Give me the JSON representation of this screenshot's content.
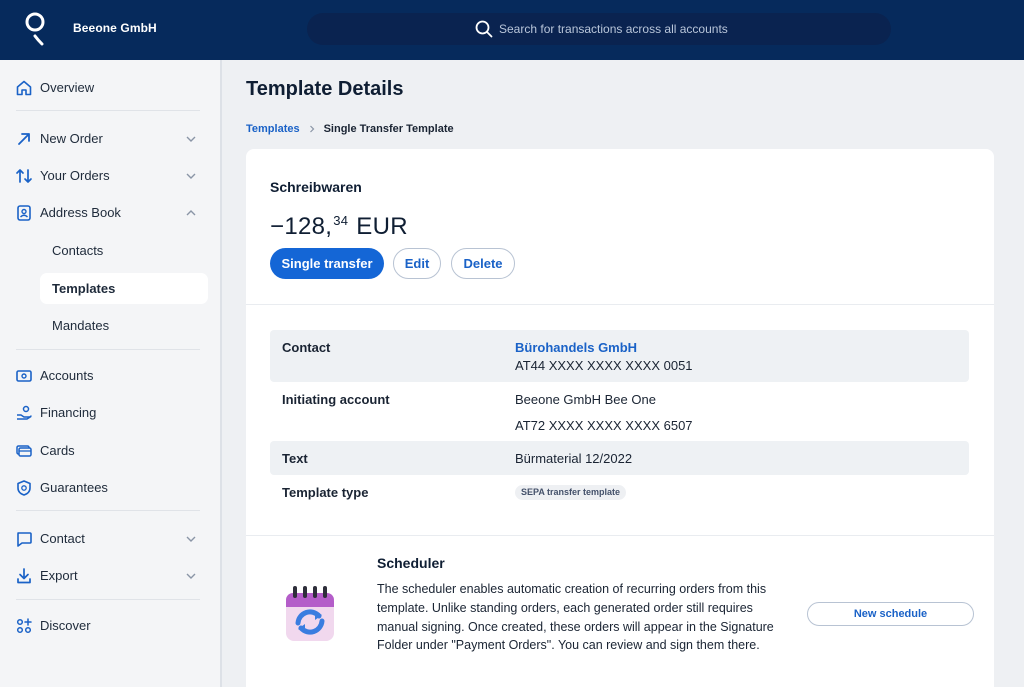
{
  "header": {
    "company": "Beeone GmbH",
    "search_placeholder": "Search for transactions across all accounts"
  },
  "sidebar": {
    "overview": "Overview",
    "new_order": "New Order",
    "your_orders": "Your Orders",
    "address_book": "Address Book",
    "contacts": "Contacts",
    "templates": "Templates",
    "mandates": "Mandates",
    "accounts": "Accounts",
    "financing": "Financing",
    "cards": "Cards",
    "guarantees": "Guarantees",
    "contact": "Contact",
    "export": "Export",
    "discover": "Discover"
  },
  "page": {
    "title": "Template Details",
    "breadcrumb": [
      "Templates",
      "Single Transfer Template"
    ]
  },
  "template": {
    "name": "Schreibwaren",
    "amount_main": "−128,",
    "amount_decimals": "34",
    "currency": "EUR",
    "buttons": {
      "single_transfer": "Single transfer",
      "edit": "Edit",
      "delete": "Delete"
    },
    "details": {
      "contact_label": "Contact",
      "contact_name": "Bürohandels GmbH",
      "contact_iban": "AT44 XXXX XXXX XXXX 0051",
      "initiating_label": "Initiating account",
      "initiating_name": "Beeone GmbH Bee One",
      "initiating_iban": "AT72 XXXX XXXX XXXX 6507",
      "text_label": "Text",
      "text_value": "Bürmaterial 12/2022",
      "type_label": "Template type",
      "type_value": "SEPA transfer template"
    }
  },
  "scheduler": {
    "title": "Scheduler",
    "description": "The scheduler enables automatic creation of recurring orders from this template. Unlike standing orders, each generated order still requires manual signing. Once created, these orders will appear in the Signature Folder under \"Payment Orders\". You can review and sign them there.",
    "button": "New schedule"
  },
  "colors": {
    "header_bg": "#062a5c",
    "primary": "#1466d6",
    "link": "#1a62c7",
    "sidebar_bg": "#f4f5f7",
    "page_bg": "#eef0f3"
  }
}
